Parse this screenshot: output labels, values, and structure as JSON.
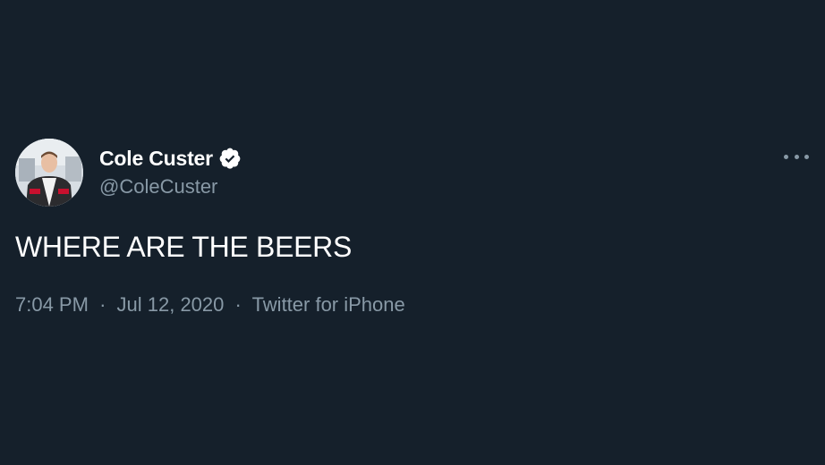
{
  "tweet": {
    "author": {
      "display_name": "Cole Custer",
      "handle": "@ColeCuster",
      "verified": true,
      "avatar_icon": "profile-photo"
    },
    "text": "WHERE ARE THE BEERS",
    "meta": {
      "time": "7:04 PM",
      "separator": "·",
      "date": "Jul 12, 2020",
      "source": "Twitter for iPhone"
    },
    "more_icon": "more-horizontal-icon"
  },
  "theme": {
    "background": "#15202b",
    "primary_text": "#ffffff",
    "secondary_text": "#8899a6"
  }
}
